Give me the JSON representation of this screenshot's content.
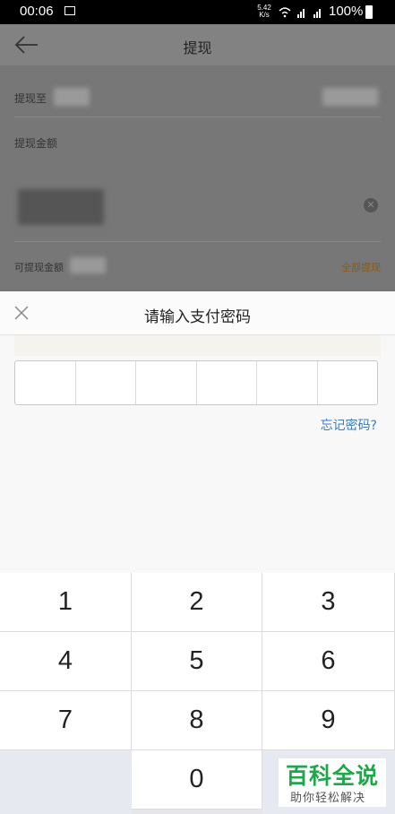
{
  "status_bar": {
    "time": "00:06",
    "speed_value": "5.42",
    "speed_unit": "K/s",
    "signal": "4G E",
    "battery": "100%"
  },
  "background_page": {
    "title": "提现",
    "withdraw_to_label": "提现至",
    "amount_label": "提现金额",
    "available_label": "可提现金额",
    "withdraw_all_label": "全部提现"
  },
  "password_sheet": {
    "title": "请输入支付密码",
    "pin_length": 6,
    "forgot_link": "忘记密码?"
  },
  "keypad": {
    "keys": [
      "1",
      "2",
      "3",
      "4",
      "5",
      "6",
      "7",
      "8",
      "9",
      "",
      "0",
      ""
    ]
  },
  "watermark": {
    "main": "百科全说",
    "sub": "助你轻松解决"
  },
  "colors": {
    "accent_link": "#3a7bbf",
    "withdraw_all": "#8a5a14",
    "watermark_green": "#1fa849"
  }
}
